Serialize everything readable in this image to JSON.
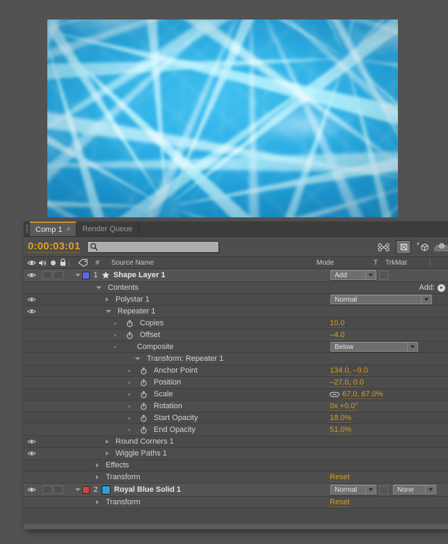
{
  "preview": {
    "name": "composition-preview",
    "description": "Underwater caustics footage, bright cyan-blue water light patterns",
    "base_color": "#1da8e0"
  },
  "panel": {
    "tabs": [
      {
        "label": "Comp 1",
        "active": true,
        "closable": true,
        "close_glyph": "×"
      },
      {
        "label": "Render Queue",
        "active": false,
        "closable": false
      }
    ],
    "timecode": "0:00:03:01",
    "search_placeholder": "",
    "search_value": "",
    "toolbar_icons": [
      {
        "name": "graph-editor-icon",
        "active": false
      },
      {
        "name": "motion-blur-toggle-icon",
        "active": true
      },
      {
        "name": "3d-renderer-icon",
        "active": false
      },
      {
        "name": "draft-3d-icon",
        "active": false
      }
    ],
    "columns": {
      "switch_icons": [
        "eye-icon",
        "speaker-icon",
        "solo-icon",
        "lock-icon"
      ],
      "tag_icon": "label-tag-icon",
      "number": "#",
      "source_name": "Source Name",
      "mode": "Mode",
      "t": "T",
      "trkmat": "TrkMat"
    },
    "add_label": "Add:",
    "colors": {
      "accent_value": "#d79c28",
      "tab_underline": "#c98f2a",
      "panel_bg": "#4a4a4a",
      "layer1_swatch": "#5d68e8",
      "layer2_swatch": "#c9453f",
      "solid_thumb": "#2e9fd6"
    }
  },
  "rows": [
    {
      "id": "shape-layer-1",
      "kind": "layer",
      "eye": true,
      "number": "1",
      "swatch": "#5d68e8",
      "icon": "star-icon",
      "name": "Shape Layer 1",
      "mode": "Add",
      "has_tbox": true,
      "trkmat": null
    },
    {
      "id": "contents",
      "kind": "group",
      "indent": 1,
      "twirl": "down",
      "name": "Contents",
      "add_label": "Add:"
    },
    {
      "id": "polystar-1",
      "kind": "group",
      "eye": true,
      "indent": 2,
      "twirl": "right",
      "name": "Polystar 1",
      "mode": "Normal"
    },
    {
      "id": "repeater-1",
      "kind": "group",
      "eye": true,
      "indent": 2,
      "twirl": "down",
      "name": "Repeater 1"
    },
    {
      "id": "copies",
      "kind": "prop",
      "indent": 3,
      "stopwatch": true,
      "name": "Copies",
      "value": "10.0"
    },
    {
      "id": "offset",
      "kind": "prop",
      "indent": 3,
      "stopwatch": true,
      "name": "Offset",
      "value": "–4.0"
    },
    {
      "id": "composite",
      "kind": "prop",
      "indent": 3,
      "stopwatch": false,
      "name": "Composite",
      "dropdown": "Below"
    },
    {
      "id": "transform-repeater-1",
      "kind": "group",
      "indent": 3,
      "twirl": "down",
      "name": "Transform: Repeater 1"
    },
    {
      "id": "anchor-point",
      "kind": "prop",
      "indent": 4,
      "stopwatch": true,
      "name": "Anchor Point",
      "value": "134.0, –9.0"
    },
    {
      "id": "position",
      "kind": "prop",
      "indent": 4,
      "stopwatch": true,
      "name": "Position",
      "value": "–27.0, 0.0"
    },
    {
      "id": "scale",
      "kind": "prop",
      "indent": 4,
      "stopwatch": true,
      "name": "Scale",
      "value": "67.0, 67.0%",
      "link_icon": true
    },
    {
      "id": "rotation",
      "kind": "prop",
      "indent": 4,
      "stopwatch": true,
      "name": "Rotation",
      "value": "0x +0.0°"
    },
    {
      "id": "start-opacity",
      "kind": "prop",
      "indent": 4,
      "stopwatch": true,
      "name": "Start Opacity",
      "value": "18.0%"
    },
    {
      "id": "end-opacity",
      "kind": "prop",
      "indent": 4,
      "stopwatch": true,
      "name": "End Opacity",
      "value": "51.0%"
    },
    {
      "id": "round-corners-1",
      "kind": "group",
      "eye": true,
      "indent": 2,
      "twirl": "right",
      "name": "Round Corners 1"
    },
    {
      "id": "wiggle-paths-1",
      "kind": "group",
      "eye": true,
      "indent": 2,
      "twirl": "right",
      "name": "Wiggle Paths 1"
    },
    {
      "id": "effects",
      "kind": "group",
      "indent": 1,
      "twirl": "right",
      "name": "Effects"
    },
    {
      "id": "transform-layer-1",
      "kind": "group",
      "indent": 1,
      "twirl": "right",
      "name": "Transform",
      "value": "Reset"
    },
    {
      "id": "royal-blue-solid-1",
      "kind": "layer",
      "eye": true,
      "number": "2",
      "swatch": "#c9453f",
      "icon": "solid-thumbnail",
      "name": "Royal Blue Solid 1",
      "mode": "Normal",
      "has_tbox": true,
      "trkmat": "None"
    },
    {
      "id": "transform-layer-2",
      "kind": "group",
      "indent": 1,
      "twirl": "right",
      "name": "Transform",
      "value": "Reset"
    }
  ]
}
